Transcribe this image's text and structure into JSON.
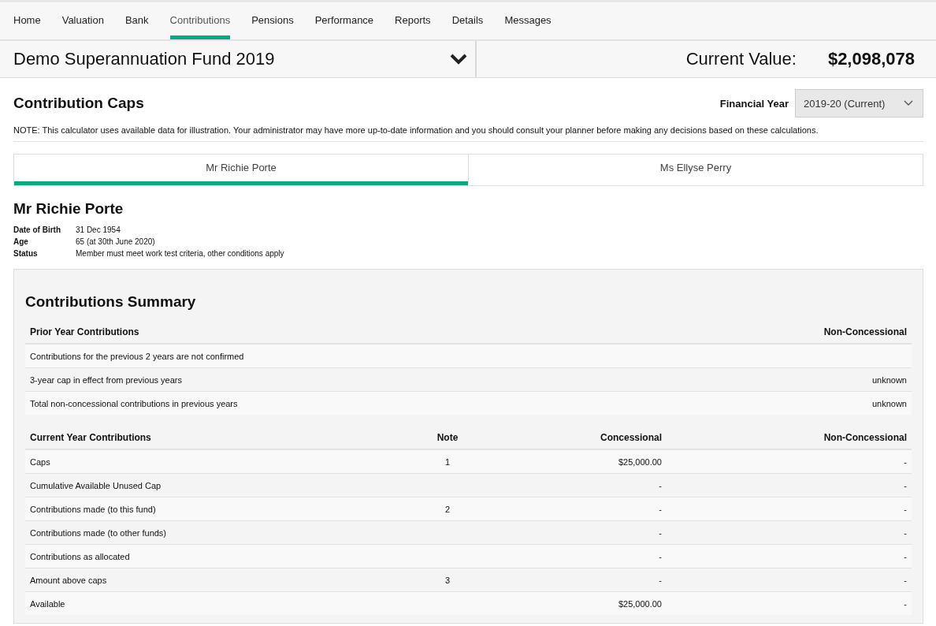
{
  "nav": [
    {
      "label": "Home",
      "selected": false
    },
    {
      "label": "Valuation",
      "selected": false
    },
    {
      "label": "Bank",
      "selected": false
    },
    {
      "label": "Contributions",
      "selected": true
    },
    {
      "label": "Pensions",
      "selected": false
    },
    {
      "label": "Performance",
      "selected": false
    },
    {
      "label": "Reports",
      "selected": false
    },
    {
      "label": "Details",
      "selected": false
    },
    {
      "label": "Messages",
      "selected": false
    }
  ],
  "fund": {
    "name": "Demo Superannuation Fund 2019",
    "value_label": "Current Value:",
    "value": "$2,098,078"
  },
  "page_title": "Contribution Caps",
  "financial_year": {
    "label": "Financial Year",
    "value": "2019-20 (Current)"
  },
  "note": "NOTE: This calculator uses available data for illustration. Your administrator may have more up-to-date information and you should consult your planner before making any decisions based on these calculations.",
  "member_tabs": [
    {
      "label": "Mr Richie Porte",
      "selected": true
    },
    {
      "label": "Ms Ellyse Perry",
      "selected": false
    }
  ],
  "member": {
    "name": "Mr Richie Porte",
    "details": [
      {
        "label": "Date of Birth",
        "value": "31 Dec 1954"
      },
      {
        "label": "Age",
        "value": "65 (at 30th June 2020)"
      },
      {
        "label": "Status",
        "value": "Member must meet work test criteria, other conditions apply"
      }
    ]
  },
  "summary": {
    "title": "Contributions Summary",
    "prior": {
      "columns": [
        "Prior Year Contributions",
        "Non-Concessional"
      ],
      "rows": [
        [
          "Contributions for the previous 2 years are not confirmed",
          ""
        ],
        [
          "3-year cap in effect from previous years",
          "unknown"
        ],
        [
          "Total non-concessional contributions in previous years",
          "unknown"
        ]
      ]
    },
    "current": {
      "columns": [
        "Current Year Contributions",
        "Note",
        "Concessional",
        "Non-Concessional"
      ],
      "rows": [
        [
          "Caps",
          "1",
          "$25,000.00",
          "-"
        ],
        [
          "Cumulative Available Unused Cap",
          "",
          "-",
          "-"
        ],
        [
          "Contributions made (to this fund)",
          "2",
          "-",
          "-"
        ],
        [
          "Contributions made (to other funds)",
          "",
          "-",
          "-"
        ],
        [
          "Contributions as allocated",
          "",
          "-",
          "-"
        ],
        [
          "Amount above caps",
          "3",
          "-",
          "-"
        ],
        [
          "Available",
          "",
          "$25,000.00",
          "-"
        ]
      ]
    }
  }
}
